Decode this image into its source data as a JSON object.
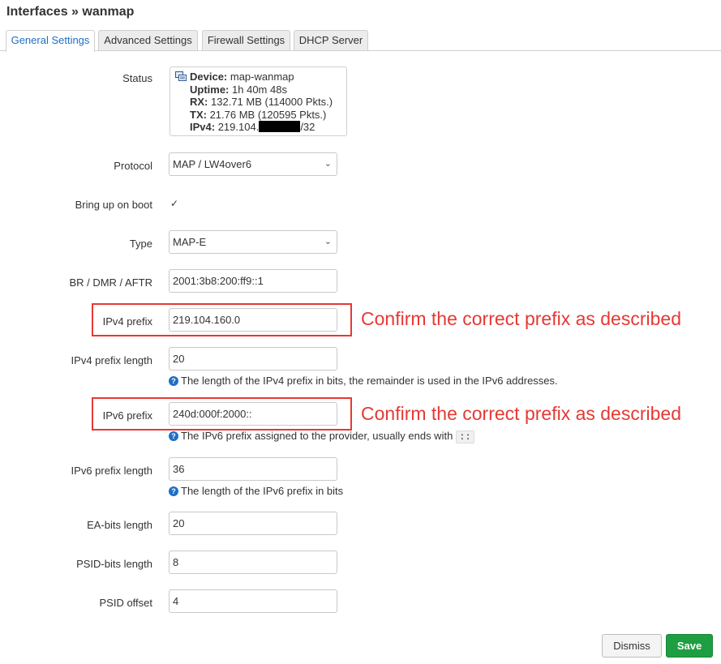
{
  "page": {
    "title": "Interfaces » wanmap"
  },
  "tabs": [
    {
      "label": "General Settings",
      "active": true
    },
    {
      "label": "Advanced Settings",
      "active": false
    },
    {
      "label": "Firewall Settings",
      "active": false
    },
    {
      "label": "DHCP Server",
      "active": false
    }
  ],
  "status": {
    "label": "Status",
    "icon": "network-device-icon",
    "device_key": "Device:",
    "device_value": "map-wanmap",
    "uptime_key": "Uptime:",
    "uptime_value": "1h 40m 48s",
    "rx_key": "RX:",
    "rx_value": "132.71 MB (114000 Pkts.)",
    "tx_key": "TX:",
    "tx_value": "21.76 MB (120595 Pkts.)",
    "ipv4_key": "IPv4:",
    "ipv4_prefix": "219.104.",
    "ipv4_suffix": "/32"
  },
  "form": {
    "protocol": {
      "label": "Protocol",
      "value": "MAP / LW4over6"
    },
    "boot": {
      "label": "Bring up on boot",
      "checked": true
    },
    "type": {
      "label": "Type",
      "value": "MAP-E"
    },
    "br": {
      "label": "BR / DMR / AFTR",
      "value": "2001:3b8:200:ff9::1"
    },
    "ipv4_prefix": {
      "label": "IPv4 prefix",
      "value": "219.104.160.0"
    },
    "ipv4_len": {
      "label": "IPv4 prefix length",
      "value": "20",
      "help": "The length of the IPv4 prefix in bits, the remainder is used in the IPv6 addresses."
    },
    "ipv6_prefix": {
      "label": "IPv6 prefix",
      "value": "240d:000f:2000::",
      "help": "The IPv6 prefix assigned to the provider, usually ends with",
      "help_code": "::"
    },
    "ipv6_len": {
      "label": "IPv6 prefix length",
      "value": "36",
      "help": "The length of the IPv6 prefix in bits"
    },
    "ea_bits": {
      "label": "EA-bits length",
      "value": "20"
    },
    "psid_bits": {
      "label": "PSID-bits length",
      "value": "8"
    },
    "psid_offset": {
      "label": "PSID offset",
      "value": "4"
    }
  },
  "annotations": {
    "ipv4_note": "Confirm the correct prefix as described",
    "ipv6_note": "Confirm the correct prefix as described",
    "color": "#e53935"
  },
  "buttons": {
    "dismiss": "Dismiss",
    "save": "Save"
  },
  "colors": {
    "accent": "#1f6fc5",
    "save": "#1e9e42"
  }
}
